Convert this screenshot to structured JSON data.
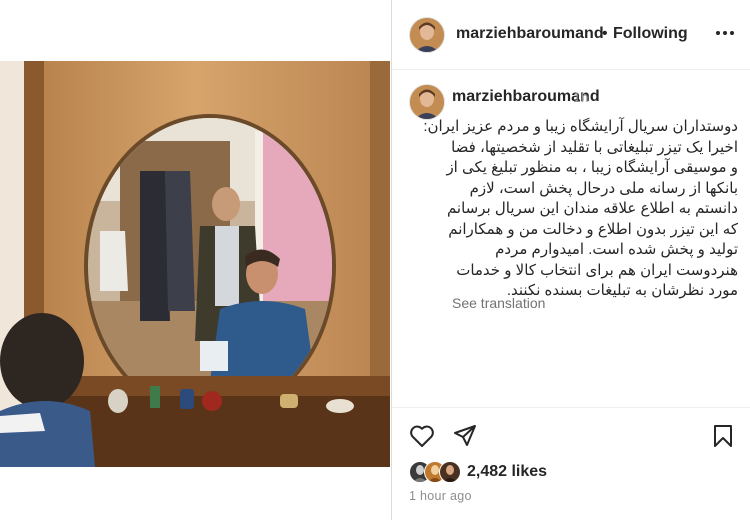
{
  "post": {
    "author": "marziehbaroumand",
    "follow_status": "Following",
    "separator": "•",
    "time_ago": "1h",
    "caption_lines": [
      "دوستداران سریال آرایشگاه زیبا و مردم عزیز ایران:",
      "اخیرا یک تیزر تبلیغاتی با تقلید از شخصیتها، فضا",
      "و موسیقی آرایشگاه زیبا ، به منظور تبلیغ یکی از",
      "بانکها از رسانه ملی درحال پخش است، لازم",
      "دانستم به اطلاع علاقه مندان این سریال برسانم",
      "که این تیزر بدون اطلاع و دخالت من و همکارانم",
      "تولید و پخش شده است. امیدوارم مردم",
      "هنردوست ایران هم برای انتخاب کالا و خدمات",
      "مورد نظرشان به تبلیغات بسنده نکنند."
    ],
    "see_translation": "See translation",
    "likes": "2,482 likes",
    "posted_time": "1 hour ago"
  },
  "icons": {
    "more": "more-options-icon",
    "like": "heart-icon",
    "share": "send-icon",
    "save": "bookmark-icon"
  },
  "colors": {
    "text": "#262626",
    "muted": "#8e8e8e",
    "divider": "#dbdbdb"
  }
}
